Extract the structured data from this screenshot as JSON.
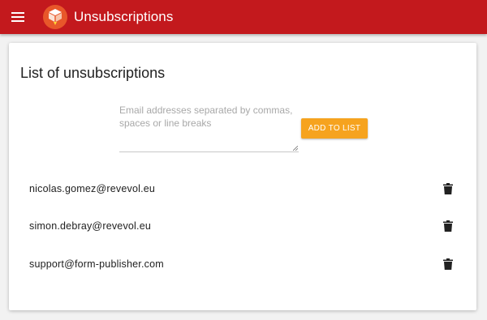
{
  "header": {
    "title": "Unsubscriptions",
    "menu_icon": "menu-icon",
    "logo_icon": "app-logo-icon",
    "bar_color": "#c3191d"
  },
  "main": {
    "title": "List of unsubscriptions",
    "email_input": {
      "placeholder": "Email addresses separated by commas, spaces or line breaks",
      "value": ""
    },
    "add_button_label": "ADD TO LIST",
    "add_button_color": "#f6a31f",
    "emails": [
      {
        "address": "nicolas.gomez@revevol.eu",
        "delete_icon": "trash-icon"
      },
      {
        "address": "simon.debray@revevol.eu",
        "delete_icon": "trash-icon"
      },
      {
        "address": "support@form-publisher.com",
        "delete_icon": "trash-icon"
      }
    ]
  }
}
